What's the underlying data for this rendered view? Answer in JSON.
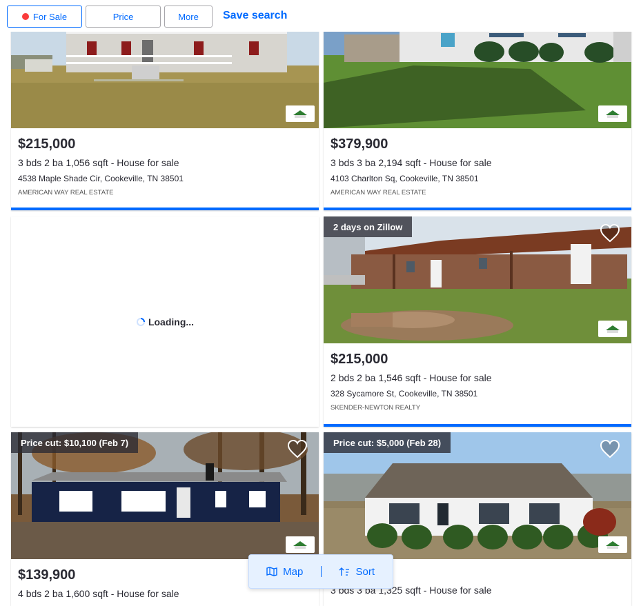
{
  "filters": {
    "for_sale_label": "For Sale",
    "price_label": "Price",
    "more_label": "More",
    "save_search_label": "Save search"
  },
  "colors": {
    "accent": "#006aff",
    "for_sale_dot": "#fa3b3b",
    "text": "#2a2a33"
  },
  "loading_label": "Loading...",
  "listings": [
    {
      "badge": "",
      "price": "$215,000",
      "beds": "3",
      "beds_unit": "bds",
      "baths": "2",
      "baths_unit": "ba",
      "sqft": "1,056",
      "sqft_unit": "sqft",
      "status": "- House for sale",
      "address": "4538 Maple Shade Cir, Cookeville, TN 38501",
      "broker": "AMERICAN WAY REAL ESTATE"
    },
    {
      "badge": "",
      "price": "$379,900",
      "beds": "3",
      "beds_unit": "bds",
      "baths": "3",
      "baths_unit": "ba",
      "sqft": "2,194",
      "sqft_unit": "sqft",
      "status": "- House for sale",
      "address": "4103 Charlton Sq, Cookeville, TN 38501",
      "broker": "AMERICAN WAY REAL ESTATE"
    },
    {
      "badge": "2 days on Zillow",
      "price": "$215,000",
      "beds": "2",
      "beds_unit": "bds",
      "baths": "2",
      "baths_unit": "ba",
      "sqft": "1,546",
      "sqft_unit": "sqft",
      "status": "- House for sale",
      "address": "328 Sycamore St, Cookeville, TN 38501",
      "broker": "SKENDER-NEWTON REALTY"
    },
    {
      "badge": "Price cut: $10,100 (Feb 7)",
      "price": "$139,900",
      "beds": "4",
      "beds_unit": "bds",
      "baths": "2",
      "baths_unit": "ba",
      "sqft": "1,600",
      "sqft_unit": "sqft",
      "status": "- House for sale"
    },
    {
      "badge": "Price cut: $5,000 (Feb 28)",
      "beds": "3",
      "beds_unit": "bds",
      "baths": "3",
      "baths_unit": "ba",
      "sqft": "1,325",
      "sqft_unit": "sqft",
      "status": "- House for sale"
    }
  ],
  "floating": {
    "map_label": "Map",
    "sort_label": "Sort",
    "map_icon": "map-icon",
    "sort_icon": "sort-icon"
  }
}
